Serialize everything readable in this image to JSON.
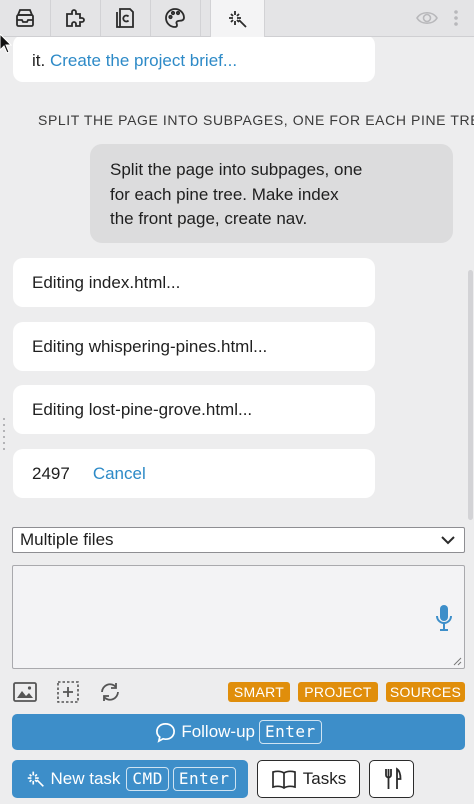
{
  "toolbar": {
    "tabs": [
      {
        "icon": "inbox-tray-icon"
      },
      {
        "icon": "puzzle-piece-icon"
      },
      {
        "icon": "copyright-document-icon"
      },
      {
        "icon": "palette-icon"
      },
      {
        "icon": "magic-sparkle-icon",
        "active": true
      }
    ],
    "right_icons": [
      "eye-icon",
      "ellipsis-icon"
    ]
  },
  "chat": {
    "partial_message": {
      "prefix": "it. ",
      "link": "Create the project brief..."
    },
    "section_heading": "SPLIT THE PAGE INTO SUBPAGES, ONE FOR EACH PINE TRE",
    "user_message": {
      "lines": [
        "Split the page into subpages, one",
        "for each pine tree. Make index",
        "the front page, create nav."
      ]
    },
    "status_items": [
      "Editing index.html...",
      "Editing whispering-pines.html...",
      "Editing lost-pine-grove.html..."
    ],
    "progress": {
      "count": "2497",
      "cancel_label": "Cancel"
    }
  },
  "input": {
    "scope_select": {
      "selected": "Multiple files"
    },
    "prompt": {
      "value": ""
    }
  },
  "tags": [
    "SMART",
    "PROJECT",
    "SOURCES"
  ],
  "actions": {
    "followup": {
      "label": "Follow-up",
      "shortcut": "Enter"
    },
    "new_task": {
      "label": "New task",
      "shortcut_mod": "CMD",
      "shortcut_key": "Enter"
    },
    "tasks": {
      "label": "Tasks"
    }
  },
  "colors": {
    "accent": "#3d8ec9",
    "link": "#2d8ac7",
    "tag": "#e08e0b",
    "background": "#ededee"
  }
}
